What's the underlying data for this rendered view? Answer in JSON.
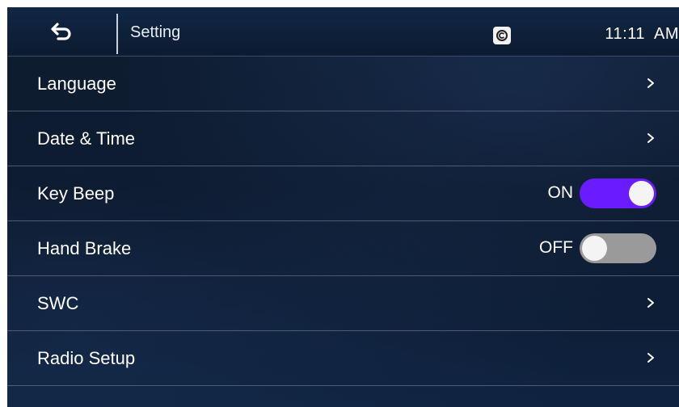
{
  "header": {
    "back_icon": "back-arrow-icon",
    "title": "Setting",
    "status_icon": "carplay-c-icon",
    "clock": "11:11  AM"
  },
  "settings": {
    "items": [
      {
        "label": "Language",
        "type": "link"
      },
      {
        "label": "Date & Time",
        "type": "link"
      },
      {
        "label": "Key Beep",
        "type": "toggle",
        "state_text": "ON",
        "on": true
      },
      {
        "label": "Hand Brake",
        "type": "toggle",
        "state_text": "OFF",
        "on": false
      },
      {
        "label": "SWC",
        "type": "link"
      },
      {
        "label": "Radio Setup",
        "type": "link"
      }
    ]
  },
  "colors": {
    "toggle_on": "#6b1bff",
    "toggle_off": "#9a9a9a",
    "background": "#0b1729"
  }
}
